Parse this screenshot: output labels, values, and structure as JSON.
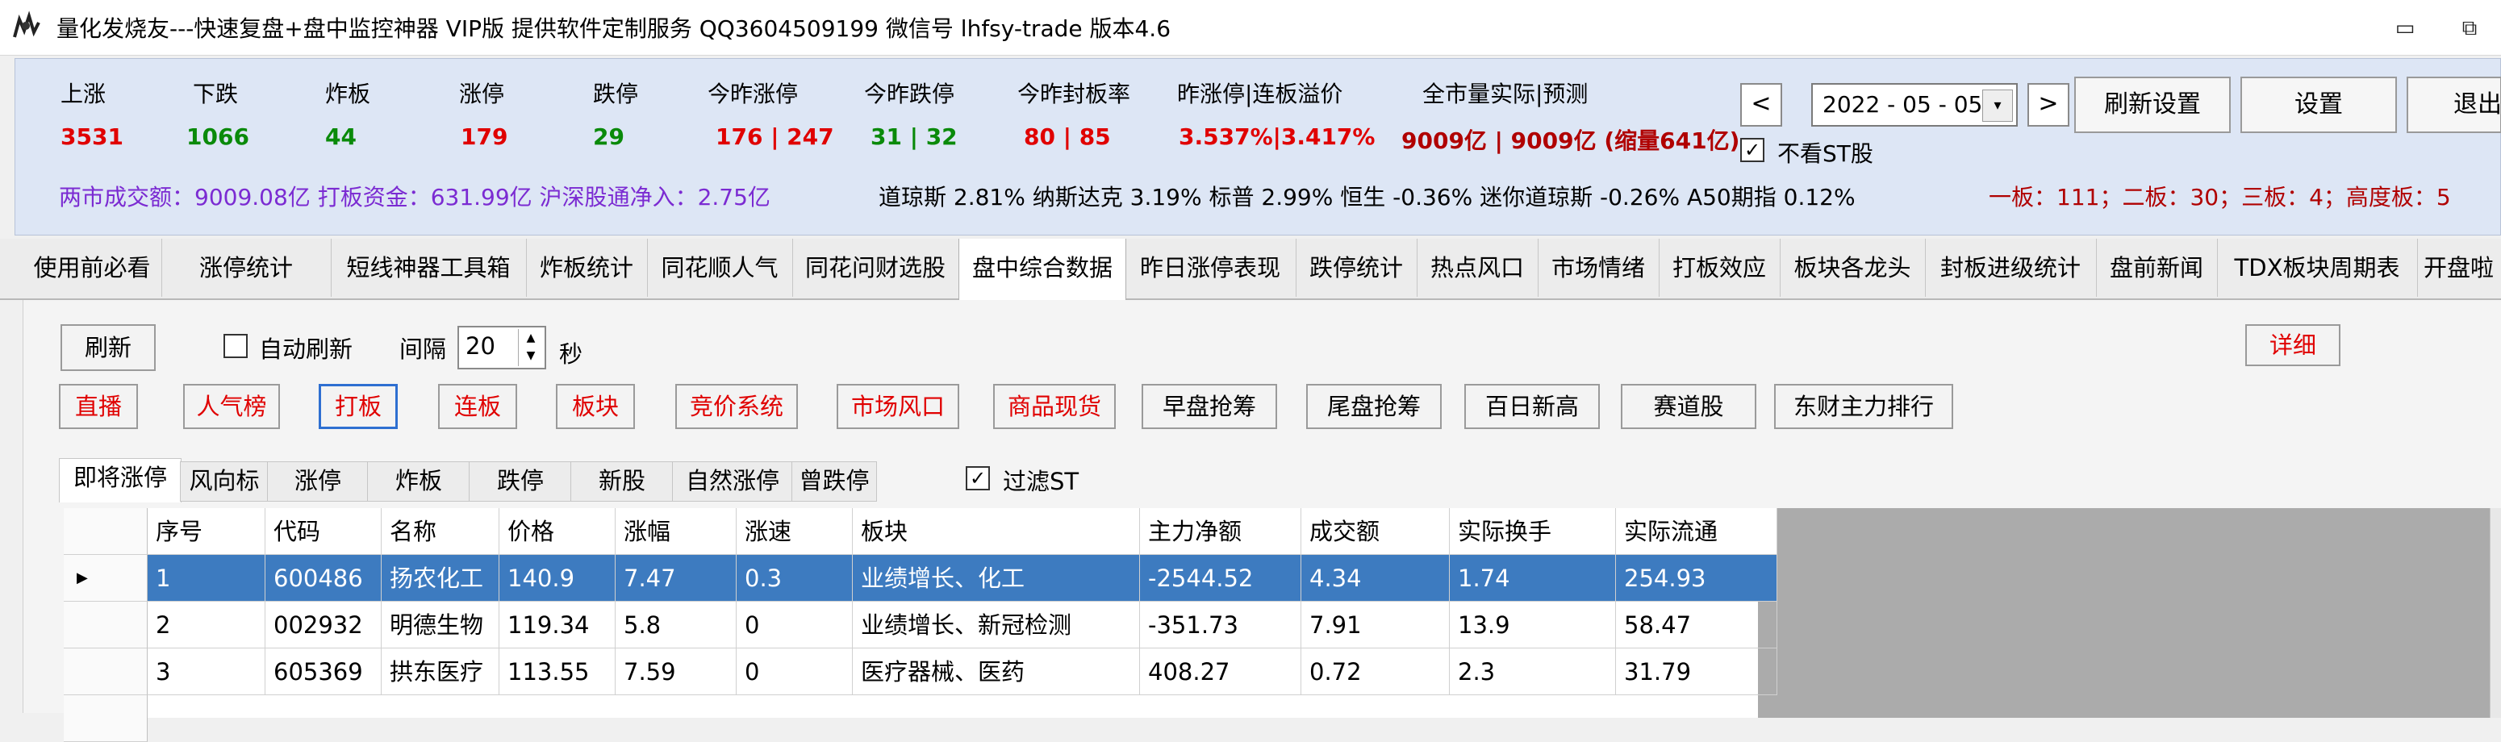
{
  "window": {
    "title": "量化发烧友---快速复盘+盘中监控神器 VIP版  提供软件定制服务 QQ3604509199 微信号 lhfsy-trade   版本4.6",
    "min_glyph": "▭",
    "max_glyph": "⧉"
  },
  "stats": {
    "headers": [
      "上涨",
      "下跌",
      "炸板",
      "涨停",
      "跌停",
      "今昨涨停",
      "今昨跌停",
      "今昨封板率",
      "昨涨停|连板溢价",
      "全市量实际|预测"
    ],
    "values": [
      "3531",
      "1066",
      "44",
      "179",
      "29",
      "176 | 247",
      "31 | 32",
      "80 | 85",
      "3.537%|3.417%",
      "9009亿 | 9009亿 (缩量641亿)"
    ],
    "date": "2022 - 05 - 05",
    "prev_glyph": "<",
    "next_glyph": ">",
    "drop_glyph": "▾",
    "buttons": [
      "刷新设置",
      "设置",
      "退出"
    ],
    "no_st_label": "不看ST股",
    "no_st_checked": true,
    "info_turnover": "两市成交额：9009.08亿  打板资金：631.99亿  沪深股通净入：2.75亿",
    "info_indices": "道琼斯 2.81%  纳斯达克 3.19%  标普 2.99%  恒生 -0.36%  迷你道琼斯 -0.26%  A50期指 0.12%",
    "info_boards": "一板：111；二板：30；三板：4；高度板：5"
  },
  "tabs": [
    "使用前必看",
    "涨停统计",
    "短线神器工具箱",
    "炸板统计",
    "同花顺人气",
    "同花问财选股",
    "盘中综合数据",
    "昨日涨停表现",
    "跌停统计",
    "热点风口",
    "市场情绪",
    "打板效应",
    "板块各龙头",
    "封板进级统计",
    "盘前新闻",
    "TDX板块周期表",
    "开盘啦"
  ],
  "active_tab": 6,
  "controls": {
    "refresh": "刷新",
    "auto_refresh": "自动刷新",
    "interval_label": "间隔",
    "interval_value": "20",
    "seconds": "秒",
    "detail": "详细"
  },
  "red_buttons": [
    "直播",
    "人气榜",
    "打板",
    "连板",
    "板块",
    "竞价系统",
    "市场风口",
    "商品现货"
  ],
  "black_buttons": [
    "早盘抢筹",
    "尾盘抢筹",
    "百日新高",
    "赛道股",
    "东财主力排行"
  ],
  "subtabs": [
    "即将涨停",
    "风向标",
    "涨停",
    "炸板",
    "跌停",
    "新股",
    "自然涨停",
    "曾跌停"
  ],
  "filter_st": "过滤ST",
  "table": {
    "columns": [
      "序号",
      "代码",
      "名称",
      "价格",
      "涨幅",
      "涨速",
      "板块",
      "主力净额",
      "成交额",
      "实际换手",
      "实际流通"
    ],
    "rows": [
      [
        "1",
        "600486",
        "扬农化工",
        "140.9",
        "7.47",
        "0.3",
        "业绩增长、化工",
        "-2544.52",
        "4.34",
        "1.74",
        "254.93"
      ],
      [
        "2",
        "002932",
        "明德生物",
        "119.34",
        "5.8",
        "0",
        "业绩增长、新冠检测",
        "-351.73",
        "7.91",
        "13.9",
        "58.47"
      ],
      [
        "3",
        "605369",
        "拱东医疗",
        "113.55",
        "7.59",
        "0",
        "医疗器械、医药",
        "408.27",
        "0.72",
        "2.3",
        "31.79"
      ]
    ],
    "selected_row": 0,
    "row_marker": "▶"
  }
}
